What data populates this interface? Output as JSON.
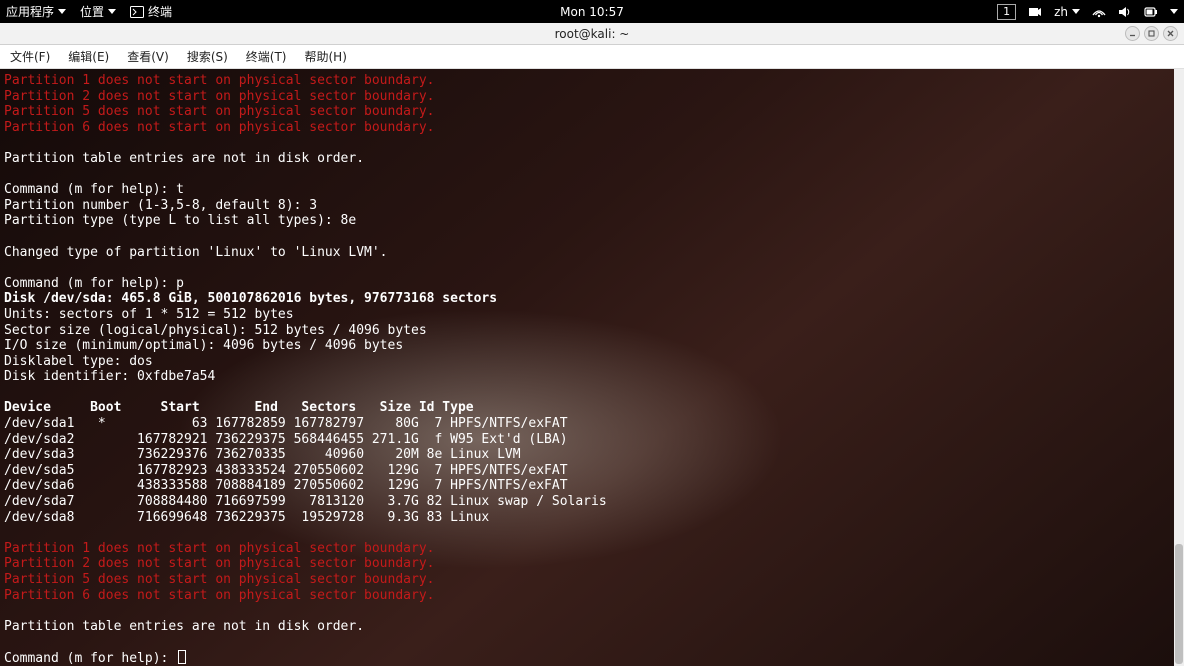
{
  "top_panel": {
    "apps": "应用程序",
    "places": "位置",
    "terminal": "终端",
    "clock": "Mon 10:57",
    "workspace_number": "1",
    "input_method": "zh"
  },
  "window": {
    "title": "root@kali: ~"
  },
  "menubar": {
    "file": "文件(F)",
    "edit": "编辑(E)",
    "view": "查看(V)",
    "search": "搜索(S)",
    "terminal": "终端(T)",
    "help": "帮助(H)"
  },
  "terminal": {
    "warnings_top": [
      "Partition 1 does not start on physical sector boundary.",
      "Partition 2 does not start on physical sector boundary.",
      "Partition 5 does not start on physical sector boundary.",
      "Partition 6 does not start on physical sector boundary."
    ],
    "order_msg": "Partition table entries are not in disk order.",
    "prompt1": "Command (m for help): t",
    "partnum": "Partition number (1-3,5-8, default 8): 3",
    "parttype": "Partition type (type L to list all types): 8e",
    "changed": "Changed type of partition 'Linux' to 'Linux LVM'.",
    "prompt2": "Command (m for help): p",
    "disk_line": "Disk /dev/sda: 465.8 GiB, 500107862016 bytes, 976773168 sectors",
    "units": "Units: sectors of 1 * 512 = 512 bytes",
    "sector_size": "Sector size (logical/physical): 512 bytes / 4096 bytes",
    "io_size": "I/O size (minimum/optimal): 4096 bytes / 4096 bytes",
    "disklabel": "Disklabel type: dos",
    "diskid": "Disk identifier: 0xfdbe7a54",
    "table_header": "Device     Boot     Start       End   Sectors   Size Id Type",
    "rows": [
      "/dev/sda1   *           63 167782859 167782797    80G  7 HPFS/NTFS/exFAT",
      "/dev/sda2        167782921 736229375 568446455 271.1G  f W95 Ext'd (LBA)",
      "/dev/sda3        736229376 736270335     40960    20M 8e Linux LVM",
      "/dev/sda5        167782923 438333524 270550602   129G  7 HPFS/NTFS/exFAT",
      "/dev/sda6        438333588 708884189 270550602   129G  7 HPFS/NTFS/exFAT",
      "/dev/sda7        708884480 716697599   7813120   3.7G 82 Linux swap / Solaris",
      "/dev/sda8        716699648 736229375  19529728   9.3G 83 Linux"
    ],
    "warnings_bottom": [
      "Partition 1 does not start on physical sector boundary.",
      "Partition 2 does not start on physical sector boundary.",
      "Partition 5 does not start on physical sector boundary.",
      "Partition 6 does not start on physical sector boundary."
    ],
    "order_msg2": "Partition table entries are not in disk order.",
    "prompt3": "Command (m for help): "
  }
}
